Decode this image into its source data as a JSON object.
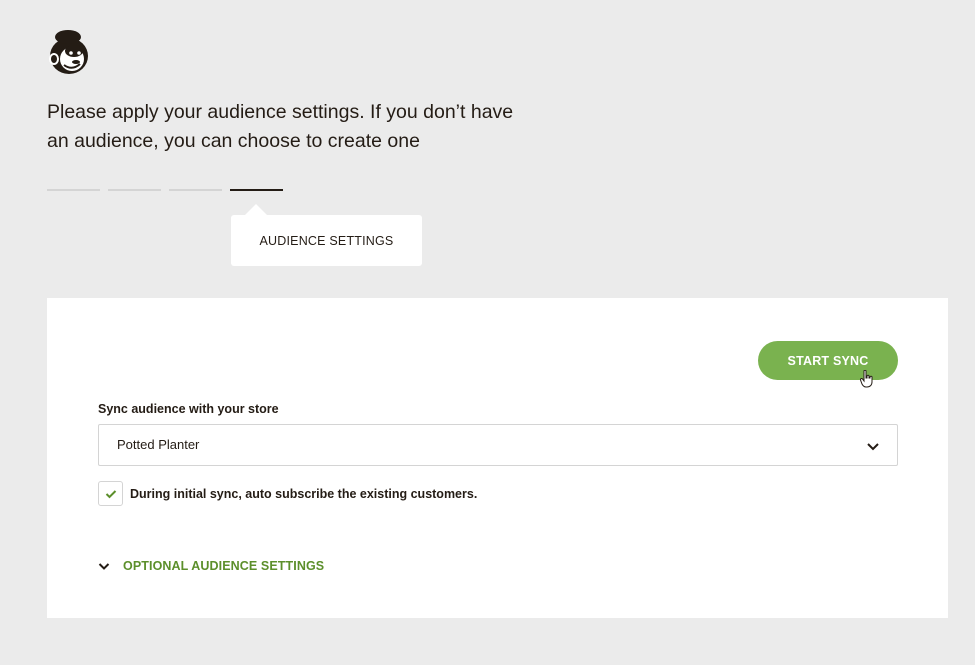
{
  "brand": {
    "logo_icon": "freddie-chimp-logo-icon"
  },
  "headline": "Please apply your audience settings. If you don’t have an audience, you can choose to create one",
  "steps": {
    "total": 4,
    "active_index": 3,
    "tooltip": "AUDIENCE SETTINGS"
  },
  "card": {
    "start_sync_label": "START SYNC",
    "sync_label": "Sync audience with your store",
    "select": {
      "value": "Potted Planter",
      "chevron_icon": "chevron-down-icon"
    },
    "auto_subscribe": {
      "checked": true,
      "label": "During initial sync, auto subscribe the existing customers."
    },
    "optional_toggle": {
      "label": "OPTIONAL AUDIENCE SETTINGS",
      "icon": "chevron-down-icon"
    }
  },
  "colors": {
    "accent_green": "#7ab24f",
    "link_green": "#5c8f2b",
    "page_bg": "#ebebeb",
    "text": "#241c15"
  }
}
